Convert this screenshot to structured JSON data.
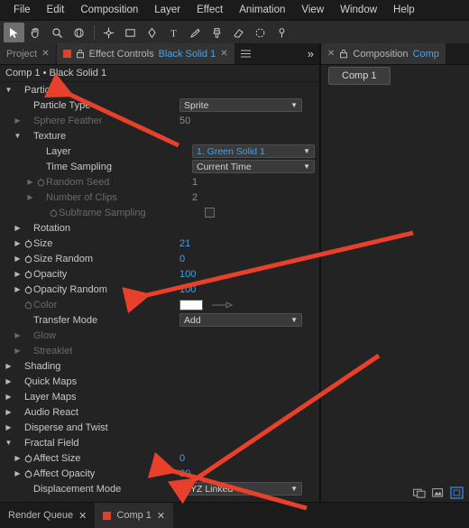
{
  "menubar": {
    "items": [
      "File",
      "Edit",
      "Composition",
      "Layer",
      "Effect",
      "Animation",
      "View",
      "Window",
      "Help"
    ]
  },
  "toolbar": {
    "tools": [
      {
        "name": "selection-tool",
        "glyph": "➤"
      },
      {
        "name": "hand-tool",
        "glyph": "✋"
      },
      {
        "name": "zoom-tool",
        "glyph": "🔍"
      },
      {
        "name": "orbit-camera-tool",
        "glyph": "⦿"
      },
      {
        "name": "pan-behind-tool",
        "glyph": "✣"
      },
      {
        "name": "shape-tool",
        "glyph": "▣"
      },
      {
        "name": "pen-tool",
        "glyph": "✒"
      },
      {
        "name": "type-tool",
        "glyph": "T"
      },
      {
        "name": "brush-tool",
        "glyph": "✎"
      },
      {
        "name": "clone-stamp-tool",
        "glyph": "⎙"
      },
      {
        "name": "eraser-tool",
        "glyph": "▭"
      },
      {
        "name": "roto-brush-tool",
        "glyph": "◐"
      },
      {
        "name": "puppet-pin-tool",
        "glyph": "✦"
      }
    ]
  },
  "left_panel": {
    "tabs": [
      {
        "name": "project-tab",
        "label": "Project",
        "active": false
      },
      {
        "name": "effect-controls-tab",
        "label": "Effect Controls",
        "highlight": "Black Solid 1",
        "active": true
      }
    ],
    "header": "Comp 1 • Black Solid 1",
    "chevron": "»"
  },
  "right_panel": {
    "tabs": [
      {
        "name": "composition-tab",
        "label": "Composition",
        "highlight": "Comp"
      }
    ],
    "comp_chip": "Comp 1"
  },
  "properties": [
    {
      "indent": 0,
      "twirl": "down",
      "label": "Particle",
      "value": "",
      "type": "group",
      "dim": false
    },
    {
      "indent": 1,
      "twirl": "",
      "label": "Particle Type",
      "value": "Sprite",
      "type": "dropdown",
      "dim": false
    },
    {
      "indent": 1,
      "twirl": "right",
      "label": "Sphere Feather",
      "value": "50",
      "type": "text",
      "dim": true
    },
    {
      "indent": 1,
      "twirl": "down",
      "label": "Texture",
      "value": "",
      "type": "group",
      "dim": false
    },
    {
      "indent": 2,
      "twirl": "",
      "label": "Layer",
      "value": "1. Green Solid 1",
      "type": "dropdown",
      "dim": false
    },
    {
      "indent": 2,
      "twirl": "",
      "label": "Time Sampling",
      "value": "Current Time",
      "type": "dropdown",
      "dim": false
    },
    {
      "indent": 2,
      "twirl": "right",
      "label": "Random Seed",
      "value": "1",
      "type": "text",
      "dim": true,
      "watch": true
    },
    {
      "indent": 2,
      "twirl": "right",
      "label": "Number of Clips",
      "value": "2",
      "type": "text",
      "dim": true
    },
    {
      "indent": 3,
      "twirl": "",
      "label": "Subframe Sampling",
      "value": "",
      "type": "checkbox",
      "dim": true,
      "watch": true
    },
    {
      "indent": 1,
      "twirl": "right",
      "label": "Rotation",
      "value": "",
      "type": "group",
      "dim": false
    },
    {
      "indent": 1,
      "twirl": "right",
      "label": "Size",
      "value": "21",
      "type": "text",
      "dim": false,
      "watch": true
    },
    {
      "indent": 1,
      "twirl": "right",
      "label": "Size Random",
      "value": "0",
      "type": "text",
      "dim": false,
      "watch": true
    },
    {
      "indent": 1,
      "twirl": "right",
      "label": "Opacity",
      "value": "100",
      "type": "text",
      "dim": false,
      "watch": true
    },
    {
      "indent": 1,
      "twirl": "right",
      "label": "Opacity Random",
      "value": "100",
      "type": "text",
      "dim": false,
      "watch": true
    },
    {
      "indent": 1,
      "twirl": "",
      "label": "Color",
      "value": "#FFFFFF",
      "type": "color",
      "dim": true,
      "watch": true
    },
    {
      "indent": 1,
      "twirl": "",
      "label": "Transfer Mode",
      "value": "Add",
      "type": "dropdown",
      "dim": false
    },
    {
      "indent": 1,
      "twirl": "right",
      "label": "Glow",
      "value": "",
      "type": "group",
      "dim": true
    },
    {
      "indent": 1,
      "twirl": "right",
      "label": "Streaklet",
      "value": "",
      "type": "group",
      "dim": true
    },
    {
      "indent": 0,
      "twirl": "right",
      "label": "Shading",
      "value": "",
      "type": "group",
      "dim": false
    },
    {
      "indent": 0,
      "twirl": "right",
      "label": "Quick Maps",
      "value": "",
      "type": "group",
      "dim": false
    },
    {
      "indent": 0,
      "twirl": "right",
      "label": "Layer Maps",
      "value": "",
      "type": "group",
      "dim": false
    },
    {
      "indent": 0,
      "twirl": "right",
      "label": "Audio React",
      "value": "",
      "type": "group",
      "dim": false
    },
    {
      "indent": 0,
      "twirl": "right",
      "label": "Disperse and Twist",
      "value": "",
      "type": "group",
      "dim": false
    },
    {
      "indent": 0,
      "twirl": "down",
      "label": "Fractal Field",
      "value": "",
      "type": "group",
      "dim": false
    },
    {
      "indent": 1,
      "twirl": "right",
      "label": "Affect Size",
      "value": "0",
      "type": "text",
      "dim": false,
      "watch": true
    },
    {
      "indent": 1,
      "twirl": "right",
      "label": "Affect Opacity",
      "value": "80",
      "type": "text",
      "dim": false,
      "watch": true
    },
    {
      "indent": 1,
      "twirl": "",
      "label": "Displacement Mode",
      "value": "XYZ Linked",
      "type": "dropdown",
      "dim": false
    }
  ],
  "bottom_bar": {
    "render_queue": "Render Queue",
    "comp_tab": "Comp 1"
  },
  "annotations": {
    "arrow_color": "#e8402a",
    "count": 4
  }
}
